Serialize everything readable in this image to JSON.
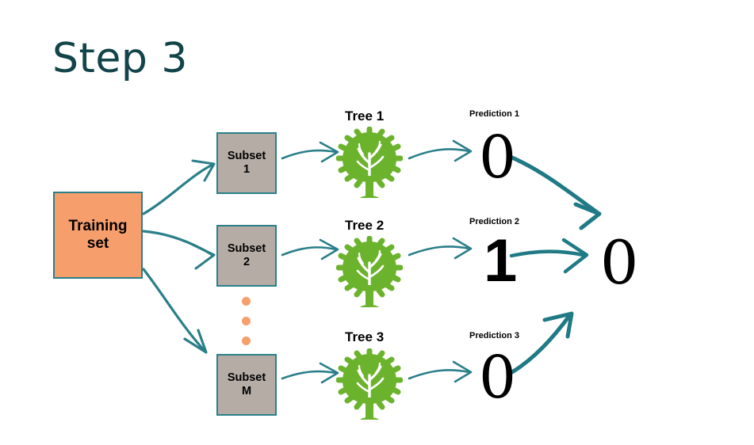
{
  "slide": {
    "title": "Step 3",
    "title_color": "#12444a",
    "background_color": "#ffffff"
  },
  "colors": {
    "accent_teal": "#2A7F89",
    "arrow_teal": "#1F7A85",
    "training_orange": "#F79E6D",
    "subset_gray": "#B5ACA6",
    "tree_green": "#6CBззз",
    "tree_green_hex": "#6CB32D",
    "digit_black": "#000000"
  },
  "diagram": {
    "training_set": {
      "label_line1": "Training",
      "label_line2": "set"
    },
    "rows": [
      {
        "subset_line1": "Subset",
        "subset_line2": "1",
        "tree_label": "Tree 1",
        "prediction_label": "Prediction 1",
        "prediction_value": "0"
      },
      {
        "subset_line1": "Subset",
        "subset_line2": "2",
        "tree_label": "Tree 2",
        "prediction_label": "Prediction 2",
        "prediction_value": "1"
      },
      {
        "subset_line1": "Subset",
        "subset_line2": "M",
        "tree_label": "Tree 3",
        "prediction_label": "Prediction 3",
        "prediction_value": "0"
      }
    ],
    "ellipsis_dot_count": 3,
    "final_prediction": "0"
  }
}
